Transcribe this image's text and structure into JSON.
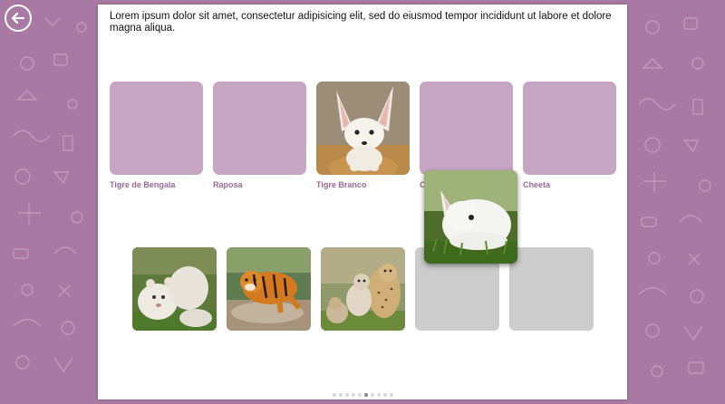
{
  "instructions": "Lorem ipsum dolor sit amet, consectetur adipisicing elit, sed do eiusmod tempor incididunt ut labore et dolore magna aliqua.",
  "slots": [
    {
      "label": "Tigre de Bengala",
      "filled": "empty"
    },
    {
      "label": "Raposa",
      "filled": "empty"
    },
    {
      "label": "Tigre Branco",
      "filled": "fennec fox photo"
    },
    {
      "label": "C",
      "filled": "empty"
    },
    {
      "label": "Cheeta",
      "filled": "empty"
    }
  ],
  "cards": [
    {
      "content": "white lion cubs photo"
    },
    {
      "content": "bengal tiger in water photo"
    },
    {
      "content": "cheetah with cubs photo"
    },
    {
      "content": "empty"
    },
    {
      "content": "empty"
    }
  ],
  "dragging_card": "white rabbit photo",
  "pager": {
    "pages": 10,
    "current": 6
  },
  "colors": {
    "background": "#a87aa3",
    "slot": "#c7a6c4",
    "label": "#9a6a94",
    "empty_card": "#cccccc",
    "panel": "#ffffff"
  },
  "icons": {
    "back": "back-arrow-icon"
  }
}
